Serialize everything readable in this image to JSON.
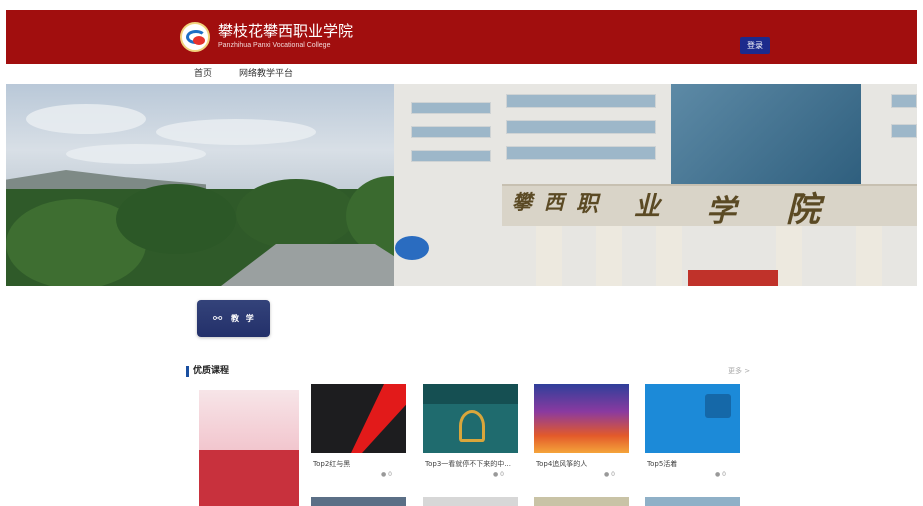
{
  "header": {
    "school_name": "攀枝花攀西职业学院",
    "school_name_en": "Panzhihua Panxi Vocational College",
    "login_label": "登录"
  },
  "nav": {
    "items": [
      {
        "label": "首页"
      },
      {
        "label": "网络教学平台"
      }
    ]
  },
  "banner": {
    "sign_text": "攀西职业学院"
  },
  "teaching": {
    "label": "教 学"
  },
  "courses": {
    "section_title": "优质课程",
    "more_label": "更多 >",
    "items": [
      {
        "title": "Top2红与黑",
        "count": "0",
        "cover": "red-black"
      },
      {
        "title": "Top3一看就停不下来的中...",
        "count": "0",
        "cover": "teal-history"
      },
      {
        "title": "Top4追风筝的人",
        "count": "0",
        "cover": "kite-runner"
      },
      {
        "title": "Top5活着",
        "count": "0",
        "cover": "blue-huozhe"
      }
    ]
  },
  "colors": {
    "header_red": "#a10e0e",
    "login_blue": "#1c2a8c",
    "teach_card": "#2b3a73",
    "section_accent": "#1a4fa0"
  }
}
